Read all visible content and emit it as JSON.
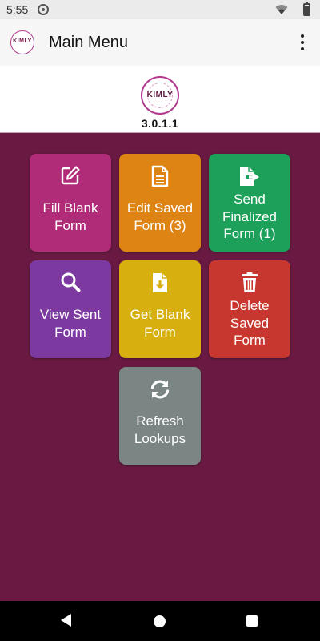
{
  "status_bar": {
    "time": "5:55",
    "icons": [
      "sync-icon",
      "wifi-icon",
      "battery-icon"
    ]
  },
  "app_bar": {
    "logo_text": "KIMLY",
    "title": "Main Menu",
    "menu_icon": "more-vert-icon"
  },
  "brand": {
    "logo_text": "KIMLY",
    "version": "3.0.1.1"
  },
  "tiles": [
    {
      "id": "fill-blank-form",
      "icon": "edit-icon",
      "label": "Fill Blank Form",
      "lines": [
        "Fill Blank",
        "Form"
      ],
      "color": "#b12c78"
    },
    {
      "id": "edit-saved-form",
      "icon": "file-text-icon",
      "label": "Edit Saved Form (3)",
      "lines": [
        "Edit Saved",
        "Form (3)"
      ],
      "color": "#de8415"
    },
    {
      "id": "send-finalized-form",
      "icon": "file-export-icon",
      "label": "Send Finalized Form (1)",
      "lines": [
        "Send",
        "Finalized",
        "Form (1)"
      ],
      "color": "#1ca05a"
    },
    {
      "id": "view-sent-form",
      "icon": "search-icon",
      "label": "View Sent Form",
      "lines": [
        "View Sent",
        "Form"
      ],
      "color": "#7c3aa0"
    },
    {
      "id": "get-blank-form",
      "icon": "file-download-icon",
      "label": "Get Blank Form",
      "lines": [
        "Get Blank",
        "Form"
      ],
      "color": "#d7af0f"
    },
    {
      "id": "delete-saved-form",
      "icon": "trash-icon",
      "label": "Delete Saved Form",
      "lines": [
        "Delete",
        "Saved",
        "Form"
      ],
      "color": "#c8372f"
    },
    {
      "id": "refresh-lookups",
      "icon": "refresh-icon",
      "label": "Refresh Lookups",
      "lines": [
        "Refresh",
        "Lookups"
      ],
      "color": "#7a8584"
    }
  ],
  "colors": {
    "background": "#6a1a42",
    "accent": "#b33a8c"
  },
  "nav_bar": {
    "icons": [
      "back-icon",
      "home-icon",
      "recents-icon"
    ]
  }
}
